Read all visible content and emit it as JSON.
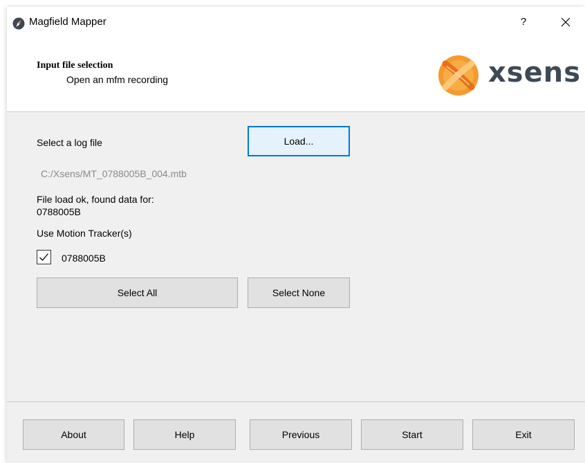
{
  "window": {
    "title": "Magfield Mapper",
    "help_symbol": "?"
  },
  "header": {
    "title": "Input file selection",
    "subtitle": "Open an mfm recording",
    "logo_text": "xsens"
  },
  "content": {
    "select_log_label": "Select a log file",
    "load_button": "Load...",
    "file_path": "C:/Xsens/MT_0788005B_004.mtb",
    "status_line1": "File load ok, found data for:",
    "status_line2": "0788005B",
    "use_trackers_label": "Use Motion Tracker(s)",
    "trackers": [
      {
        "id": "0788005B",
        "checked": true
      }
    ],
    "select_all_button": "Select All",
    "select_none_button": "Select None"
  },
  "footer": {
    "about": "About",
    "help": "Help",
    "previous": "Previous",
    "start": "Start",
    "exit": "Exit"
  },
  "colors": {
    "accent": "#0078d7",
    "logo_orange": "#f28c28",
    "logo_text": "#3d4a55"
  }
}
